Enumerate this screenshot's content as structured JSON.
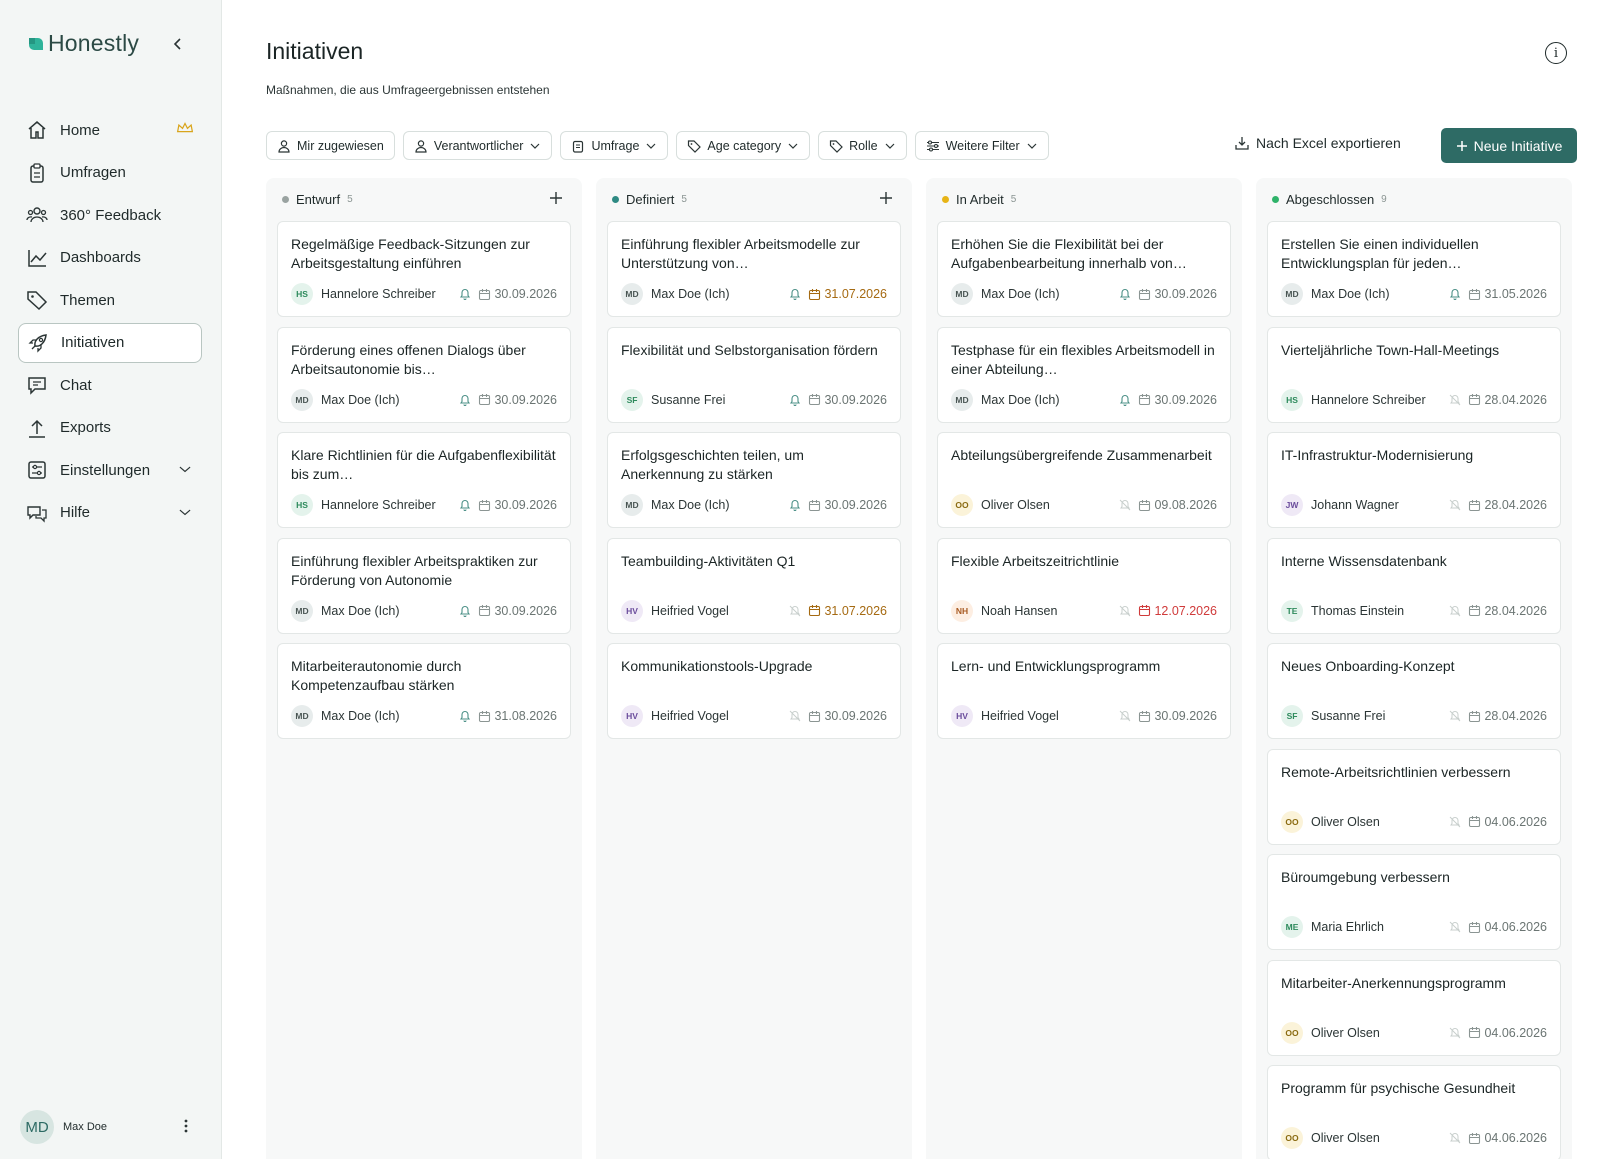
{
  "app": {
    "name": "Honestly",
    "brand_color": "#2e6b65"
  },
  "sidebar": {
    "items": [
      {
        "label": "Home",
        "icon": "home-icon",
        "trail": "crown-icon"
      },
      {
        "label": "Umfragen",
        "icon": "clipboard-icon"
      },
      {
        "label": "360° Feedback",
        "icon": "people-icon"
      },
      {
        "label": "Dashboards",
        "icon": "chart-icon"
      },
      {
        "label": "Themen",
        "icon": "tag-icon"
      },
      {
        "label": "Initiativen",
        "icon": "rocket-icon",
        "active": true
      },
      {
        "label": "Chat",
        "icon": "chat-icon"
      },
      {
        "label": "Exports",
        "icon": "upload-icon"
      },
      {
        "label": "Einstellungen",
        "icon": "settings-icon",
        "trail": "chevron-down-icon"
      },
      {
        "label": "Hilfe",
        "icon": "help-icon",
        "trail": "chevron-down-icon"
      }
    ],
    "user": {
      "initials": "MD",
      "name": "Max Doe"
    }
  },
  "header": {
    "title": "Initiativen",
    "subtitle": "Maßnahmen, die aus Umfrageergebnissen entstehen"
  },
  "filters": [
    {
      "label": "Mir zugewiesen",
      "icon": "user-icon",
      "chevron": false
    },
    {
      "label": "Verantwortlicher",
      "icon": "user-icon",
      "chevron": true
    },
    {
      "label": "Umfrage",
      "icon": "clipboard-icon",
      "chevron": true
    },
    {
      "label": "Age category",
      "icon": "tag-icon",
      "chevron": true
    },
    {
      "label": "Rolle",
      "icon": "tag-icon",
      "chevron": true
    },
    {
      "label": "Weitere Filter",
      "icon": "sliders-icon",
      "chevron": true
    }
  ],
  "actions": {
    "export_label": "Nach Excel exportieren",
    "new_label": "Neue Initiative"
  },
  "columns": [
    {
      "name": "Entwurf",
      "count": "5",
      "dot": "#9aa3a1",
      "addable": true,
      "cards": [
        {
          "title": "Regelmäßige Feedback-Sitzungen zur Arbeitsgestaltung einführen",
          "initials": "HS",
          "owner": "Hannelore Schreiber",
          "notify": true,
          "date": "30.09.2026",
          "date_state": "normal"
        },
        {
          "title": "Förderung eines offenen Dialogs über Arbeitsautonomie bis…",
          "initials": "MD",
          "owner": "Max Doe (Ich)",
          "notify": true,
          "date": "30.09.2026",
          "date_state": "normal"
        },
        {
          "title": "Klare Richtlinien für die Aufgabenflexibilität bis zum…",
          "initials": "HS",
          "owner": "Hannelore Schreiber",
          "notify": true,
          "date": "30.09.2026",
          "date_state": "normal"
        },
        {
          "title": "Einführung flexibler Arbeitspraktiken zur Förderung von Autonomie",
          "initials": "MD",
          "owner": "Max Doe (Ich)",
          "notify": true,
          "date": "30.09.2026",
          "date_state": "normal"
        },
        {
          "title": "Mitarbeiterautonomie durch Kompetenzaufbau stärken",
          "initials": "MD",
          "owner": "Max Doe (Ich)",
          "notify": true,
          "date": "31.08.2026",
          "date_state": "normal"
        }
      ]
    },
    {
      "name": "Definiert",
      "count": "5",
      "dot": "#2e8a83",
      "addable": true,
      "cards": [
        {
          "title": "Einführung flexibler Arbeitsmodelle zur Unterstützung von…",
          "initials": "MD",
          "owner": "Max Doe (Ich)",
          "notify": true,
          "date": "31.07.2026",
          "date_state": "warn"
        },
        {
          "title": "Flexibilität und Selbstorganisation fördern",
          "initials": "SF",
          "owner": "Susanne Frei",
          "notify": true,
          "date": "30.09.2026",
          "date_state": "normal"
        },
        {
          "title": "Erfolgsgeschichten teilen, um Anerkennung zu stärken",
          "initials": "MD",
          "owner": "Max Doe (Ich)",
          "notify": true,
          "date": "30.09.2026",
          "date_state": "normal"
        },
        {
          "title": "Teambuilding-Aktivitäten Q1",
          "initials": "HV",
          "owner": "Heifried Vogel",
          "notify": false,
          "date": "31.07.2026",
          "date_state": "warn"
        },
        {
          "title": "Kommunikationstools-Upgrade",
          "initials": "HV",
          "owner": "Heifried Vogel",
          "notify": false,
          "date": "30.09.2026",
          "date_state": "normal"
        }
      ]
    },
    {
      "name": "In Arbeit",
      "count": "5",
      "dot": "#e7b417",
      "addable": false,
      "cards": [
        {
          "title": "Erhöhen Sie die Flexibilität bei der Aufgabenbearbeitung innerhalb von…",
          "initials": "MD",
          "owner": "Max Doe (Ich)",
          "notify": true,
          "date": "30.09.2026",
          "date_state": "normal"
        },
        {
          "title": "Testphase für ein flexibles Arbeitsmodell in einer Abteilung…",
          "initials": "MD",
          "owner": "Max Doe (Ich)",
          "notify": true,
          "date": "30.09.2026",
          "date_state": "normal"
        },
        {
          "title": "Abteilungsübergreifende Zusammenarbeit",
          "initials": "OO",
          "owner": "Oliver Olsen",
          "notify": false,
          "date": "09.08.2026",
          "date_state": "normal"
        },
        {
          "title": "Flexible Arbeitszeitrichtlinie",
          "initials": "NH",
          "owner": "Noah Hansen",
          "notify": false,
          "date": "12.07.2026",
          "date_state": "danger"
        },
        {
          "title": "Lern- und Entwicklungsprogramm",
          "initials": "HV",
          "owner": "Heifried Vogel",
          "notify": false,
          "date": "30.09.2026",
          "date_state": "normal"
        }
      ]
    },
    {
      "name": "Abgeschlossen",
      "count": "9",
      "dot": "#2fb36a",
      "addable": false,
      "cards": [
        {
          "title": "Erstellen Sie einen individuellen Entwicklungsplan für jeden…",
          "initials": "MD",
          "owner": "Max Doe (Ich)",
          "notify": true,
          "date": "31.05.2026",
          "date_state": "normal"
        },
        {
          "title": "Vierteljährliche Town-Hall-Meetings",
          "initials": "HS",
          "owner": "Hannelore Schreiber",
          "notify": false,
          "date": "28.04.2026",
          "date_state": "normal"
        },
        {
          "title": "IT-Infrastruktur-Modernisierung",
          "initials": "JW",
          "owner": "Johann Wagner",
          "notify": false,
          "date": "28.04.2026",
          "date_state": "normal"
        },
        {
          "title": "Interne Wissensdatenbank",
          "initials": "TE",
          "owner": "Thomas Einstein",
          "notify": false,
          "date": "28.04.2026",
          "date_state": "normal"
        },
        {
          "title": "Neues Onboarding-Konzept",
          "initials": "SF",
          "owner": "Susanne Frei",
          "notify": false,
          "date": "28.04.2026",
          "date_state": "normal"
        },
        {
          "title": "Remote-Arbeitsrichtlinien verbessern",
          "initials": "OO",
          "owner": "Oliver Olsen",
          "notify": false,
          "date": "04.06.2026",
          "date_state": "normal"
        },
        {
          "title": "Büroumgebung verbessern",
          "initials": "ME",
          "owner": "Maria Ehrlich",
          "notify": false,
          "date": "04.06.2026",
          "date_state": "normal"
        },
        {
          "title": "Mitarbeiter-Anerkennungsprogramm",
          "initials": "OO",
          "owner": "Oliver Olsen",
          "notify": false,
          "date": "04.06.2026",
          "date_state": "normal"
        },
        {
          "title": "Programm für psychische Gesundheit",
          "initials": "OO",
          "owner": "Oliver Olsen",
          "notify": false,
          "date": "04.06.2026",
          "date_state": "normal"
        }
      ]
    }
  ],
  "avatar_colors": {
    "MD": {
      "bg": "#e7ecec",
      "fg": "#4a5654"
    },
    "HS": {
      "bg": "#e4f3ec",
      "fg": "#2d8a5c"
    },
    "SF": {
      "bg": "#e4f3ec",
      "fg": "#2d8a5c"
    },
    "HV": {
      "bg": "#efe9f6",
      "fg": "#6a4c9c"
    },
    "OO": {
      "bg": "#fbf3d9",
      "fg": "#8a6a10"
    },
    "NH": {
      "bg": "#fdeee2",
      "fg": "#a85a22"
    },
    "JW": {
      "bg": "#efe9f6",
      "fg": "#6a4c9c"
    },
    "TE": {
      "bg": "#e4f3ec",
      "fg": "#2d8a5c"
    },
    "ME": {
      "bg": "#e4f3ec",
      "fg": "#2d8a5c"
    }
  }
}
